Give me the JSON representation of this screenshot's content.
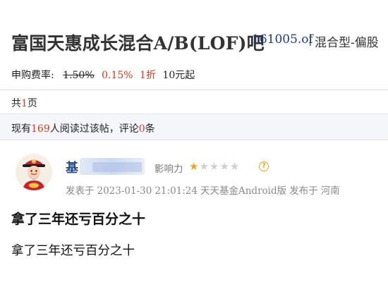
{
  "header": {
    "title": "富国天惠成长混合A/B(LOF)吧",
    "fund_code": "161005.of",
    "separator": "|",
    "fund_type": "混合型-偏股"
  },
  "fee": {
    "label": "申购费率:",
    "original": "1.50%",
    "current": "0.15%",
    "discount": "1折",
    "minimum": "10元起"
  },
  "pager": {
    "prefix": "共",
    "count": "1",
    "suffix": "页"
  },
  "stats": {
    "prefix": "现有",
    "readers": "169",
    "middle": "人阅读过该帖，评论",
    "comments": "0",
    "suffix": "条"
  },
  "post": {
    "username": "基",
    "influence_label": "影响力",
    "influence_stars": 1,
    "influence_max": 5,
    "meta_prefix": "发表于",
    "date": "2023-01-30",
    "time": "21:01:24",
    "client": "天天基金Android版",
    "location_prefix": "发布于",
    "location": "河南",
    "title": "拿了三年还亏百分之十",
    "body": "拿了三年还亏百分之十"
  },
  "icons": {
    "help": "question-circle-icon",
    "star": "star-icon",
    "avatar": "fortune-god-avatar"
  },
  "colors": {
    "accent_red": "#d9381e",
    "link_blue": "#1a3a8a",
    "star_gold": "#f3a21c"
  }
}
